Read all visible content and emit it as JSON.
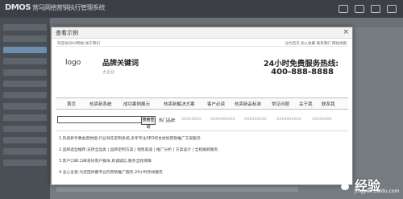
{
  "app": {
    "brand": "DMOS",
    "title": "营马网络营销执行管理系统"
  },
  "dialog": {
    "title": "查看示例",
    "close": "×"
  },
  "site": {
    "topbar_left": "欢迎访问XX网站!关于我们",
    "topbar_right": "设为首页  加入收藏  联系我们  网站地图",
    "logo": "logo",
    "slogan_main": "品牌关键词",
    "slogan_sub": "大企业",
    "hotline_label": "24小时免费服务热线:",
    "hotline_number": "400-888-8888",
    "nav": [
      "首页",
      "热卖新系统",
      "成功案例展示",
      "热卖新解决方案",
      "客户必读",
      "热卖新品标准",
      "常见问题",
      "关于我",
      "联系我"
    ],
    "search": {
      "value": "",
      "button": "搜索查询",
      "hot_label": "热门品牌:",
      "hot_items": [
        "XXXXXXXX",
        "XXXXXXXXXX",
        "XXXXXXXXX",
        "XXXXXXXXXX",
        "XXXXXXXX"
      ]
    },
    "content_lines": [
      "1.热卖新手黄金搭档组:行业领先定制系统,多年专注SEO综合规划营销推广方案服务",
      "2.品牌选型推荐:支持全品类 | 品牌定制方案 | 销售渠道 | 推广分析 | 方案设计 | 全程跟踪服务",
      "3.客户口碑:口碑良好客户群体,真诚诚信,服务全程保障",
      "4.全心全意:为您提供最专业的营销推广服务,24小时热线服务"
    ]
  },
  "watermark": {
    "text": "经验",
    "url": "jingyan.baidu.com"
  },
  "colors": {
    "background": "#5a5e63",
    "dialog_bg": "#ffffff",
    "nav_border": "#bfbfbf"
  }
}
